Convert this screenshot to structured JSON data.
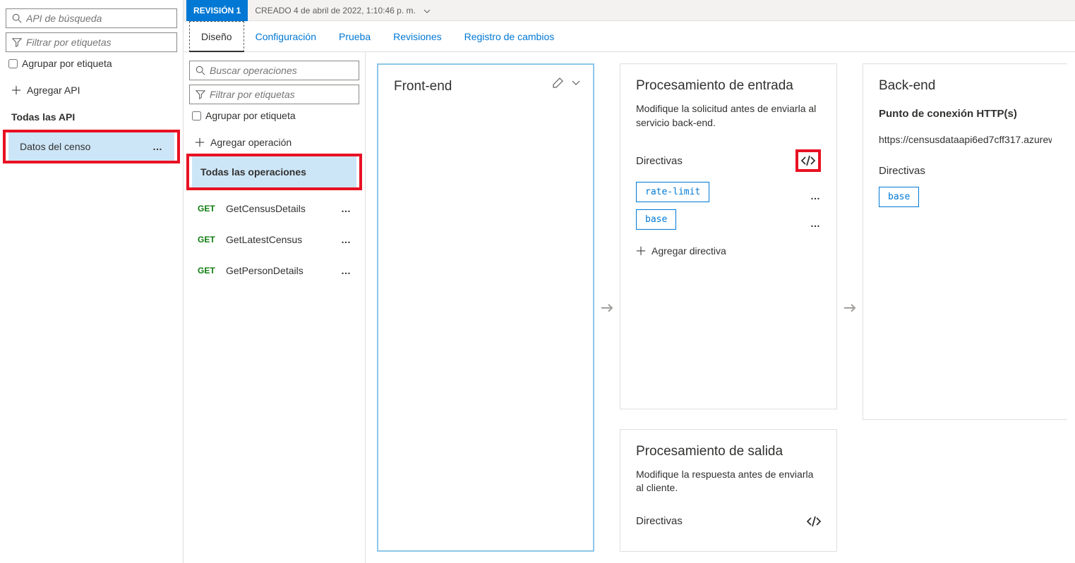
{
  "sidebar": {
    "search_placeholder": "API de búsqueda",
    "filter_placeholder": "Filtrar por etiquetas",
    "group_label": "Agrupar por etiqueta",
    "add_api_label": "Agregar API",
    "all_apis_label": "Todas las API",
    "selected_api": "Datos del censo"
  },
  "topbar": {
    "revision_label": "REVISIÓN 1",
    "created_label": "CREADO 4 de abril de 2022, 1:10:46 p. m."
  },
  "tabs": {
    "design": "Diseño",
    "config": "Configuración",
    "test": "Prueba",
    "revisions": "Revisiones",
    "changelog": "Registro de cambios"
  },
  "operations": {
    "search_placeholder": "Buscar operaciones",
    "filter_placeholder": "Filtrar por etiquetas",
    "group_label": "Agrupar por etiqueta",
    "add_op_label": "Agregar operación",
    "all_ops_label": "Todas las operaciones",
    "list": [
      {
        "method": "GET",
        "name": "GetCensusDetails"
      },
      {
        "method": "GET",
        "name": "GetLatestCensus"
      },
      {
        "method": "GET",
        "name": "GetPersonDetails"
      }
    ]
  },
  "frontend": {
    "title": "Front-end"
  },
  "inbound": {
    "title": "Procesamiento de entrada",
    "desc": "Modifique la solicitud antes de enviarla al servicio back-end.",
    "directives_label": "Directivas",
    "policies": [
      "rate-limit",
      "base"
    ],
    "add_policy_label": "Agregar directiva"
  },
  "outbound": {
    "title": "Procesamiento de salida",
    "desc": "Modifique la respuesta antes de enviarla al cliente.",
    "directives_label": "Directivas"
  },
  "backend": {
    "title": "Back-end",
    "endpoint_label": "Punto de conexión HTTP(s)",
    "endpoint_url": "https://censusdataapi6ed7cff317.azurew",
    "directives_label": "Directivas",
    "policies": [
      "base"
    ]
  }
}
